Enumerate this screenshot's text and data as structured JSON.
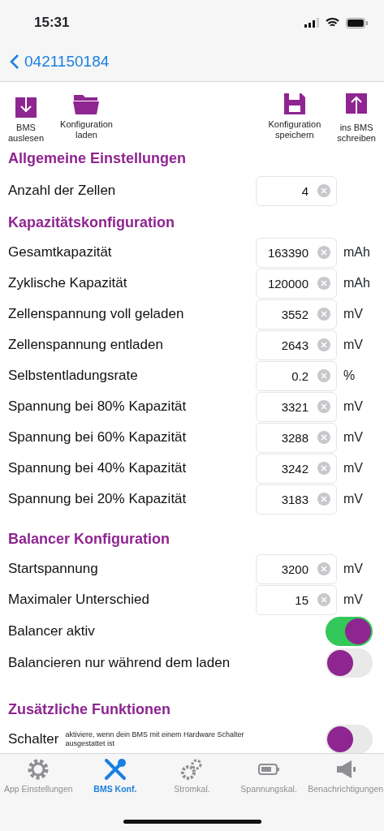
{
  "status_bar": {
    "time": "15:31"
  },
  "nav": {
    "back_label": "0421150184"
  },
  "toolbar": {
    "left": [
      {
        "label": "BMS\nauslesen"
      },
      {
        "label": "Konfiguration\nladen"
      }
    ],
    "right": [
      {
        "label": "Konfiguration\nspeichern"
      },
      {
        "label": "ins BMS\nschreiben"
      }
    ]
  },
  "sections": [
    {
      "title": "Allgemeine Einstellungen",
      "rows": [
        {
          "kind": "field",
          "label": "Anzahl der Zellen",
          "value": "4"
        }
      ]
    },
    {
      "title": "Kapazitätskonfiguration",
      "rows": [
        {
          "kind": "field",
          "label": "Gesamtkapazität",
          "value": "163390",
          "unit": "mAh"
        },
        {
          "kind": "field",
          "label": "Zyklische Kapazität",
          "value": "120000",
          "unit": "mAh"
        },
        {
          "kind": "field",
          "label": "Zellenspannung voll geladen",
          "value": "3552",
          "unit": "mV"
        },
        {
          "kind": "field",
          "label": "Zellenspannung entladen",
          "value": "2643",
          "unit": "mV"
        },
        {
          "kind": "field",
          "label": "Selbstentladungsrate",
          "value": "0.2",
          "unit": "%"
        },
        {
          "kind": "field",
          "label": "Spannung bei 80% Kapazität",
          "value": "3321",
          "unit": "mV"
        },
        {
          "kind": "field",
          "label": "Spannung bei 60% Kapazität",
          "value": "3288",
          "unit": "mV"
        },
        {
          "kind": "field",
          "label": "Spannung bei 40% Kapazität",
          "value": "3242",
          "unit": "mV"
        },
        {
          "kind": "field",
          "label": "Spannung bei 20% Kapazität",
          "value": "3183",
          "unit": "mV"
        }
      ]
    },
    {
      "title": "Balancer Konfiguration",
      "rows": [
        {
          "kind": "field",
          "label": "Startspannung",
          "value": "3200",
          "unit": "mV"
        },
        {
          "kind": "field",
          "label": "Maximaler Unterschied",
          "value": "15",
          "unit": "mV"
        },
        {
          "kind": "toggle",
          "label": "Balancer aktiv",
          "on": true
        },
        {
          "kind": "toggle",
          "label": "Balancieren nur während dem laden",
          "on": false
        }
      ]
    },
    {
      "title": "Zusätzliche Funktionen",
      "rows": [
        {
          "kind": "toggle",
          "label": "Schalter",
          "note": "aktiviere, wenn dein BMS mit einem Hardware Schalter ausgestattet ist",
          "on": false
        }
      ]
    }
  ],
  "tabs": [
    {
      "label": "App Einstellungen",
      "selected": false
    },
    {
      "label": "BMS Konf.",
      "selected": true
    },
    {
      "label": "Stromkal.",
      "selected": false
    },
    {
      "label": "Spannungskal.",
      "selected": false
    },
    {
      "label": "Benachrichtigungen",
      "selected": false
    }
  ]
}
